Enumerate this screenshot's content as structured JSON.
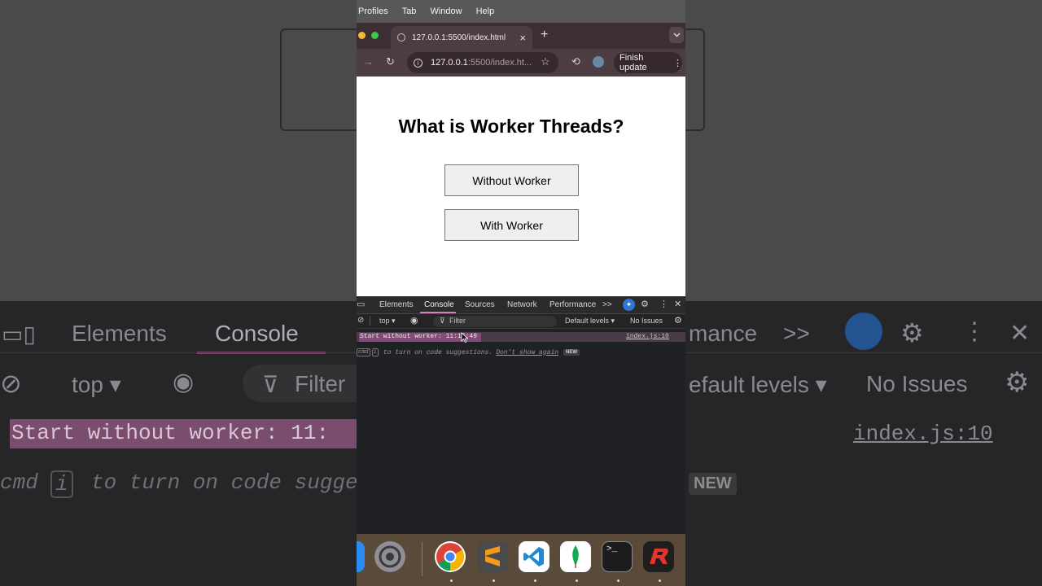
{
  "menubar": {
    "items": [
      "Profiles",
      "Tab",
      "Window",
      "Help"
    ]
  },
  "browser": {
    "tab_title": "127.0.0.1:5500/index.html",
    "tab_close": "×",
    "new_tab": "+",
    "url_host": "127.0.0.1",
    "url_rest": ":5500/index.ht...",
    "finish_update_label": "Finish update"
  },
  "page": {
    "heading": "What is Worker Threads?",
    "button_without": "Without Worker",
    "button_with": "With Worker"
  },
  "devtools": {
    "tabs": [
      "Elements",
      "Console",
      "Sources",
      "Network",
      "Performance"
    ],
    "more_tabs": ">>",
    "context": "top ▾",
    "filter_placeholder": "Filter",
    "levels": "Default levels ▾",
    "issues": "No Issues",
    "log_message": "Start without worker: 11:15:49",
    "log_source": "index.js:10",
    "hint_key1": "cmd",
    "hint_key2": "i",
    "hint_text": "to turn on code suggestions.",
    "hint_link": "Don't show again",
    "hint_badge": "NEW"
  },
  "background": {
    "tab_elements": "Elements",
    "tab_console": "Console",
    "tab_perf": "mance",
    "tab_more": ">>",
    "context": "top ▾",
    "filter": "Filter",
    "levels": "efault levels ▾",
    "issues": "No Issues",
    "log": "Start without worker: 11:",
    "log_tail": "S",
    "source": "index.js:10",
    "hint_key": "cmd",
    "hint_key2": "i",
    "hint_text": "to turn on code sugge",
    "badge": "NEW"
  },
  "dock": {
    "apps": [
      "finder",
      "system-settings",
      "chrome",
      "sublime-text",
      "vscode",
      "mongodb-compass",
      "terminal",
      "redis-insight"
    ]
  },
  "colors": {
    "accent_pink": "#d47fbf",
    "log_highlight": "#b45aa0",
    "copilot_blue": "#2f76d6"
  }
}
